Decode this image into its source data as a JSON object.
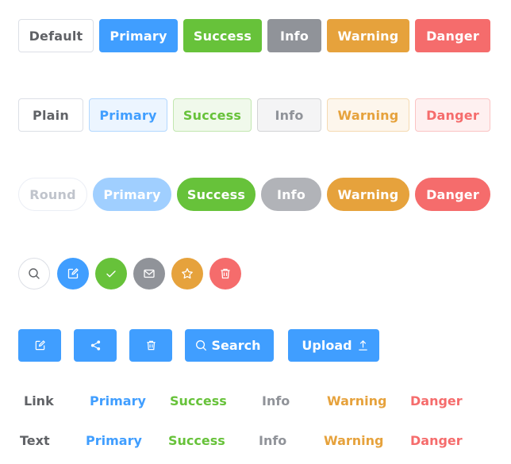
{
  "colors": {
    "primary": "#409eff",
    "success": "#67c23a",
    "info": "#909399",
    "warning": "#e6a23c",
    "danger": "#f56c6c",
    "default_text": "#606266"
  },
  "row_default": {
    "default": "Default",
    "primary": "Primary",
    "success": "Success",
    "info": "Info",
    "warning": "Warning",
    "danger": "Danger"
  },
  "row_plain": {
    "plain": "Plain",
    "primary": "Primary",
    "success": "Success",
    "info": "Info",
    "warning": "Warning",
    "danger": "Danger"
  },
  "row_round": {
    "round": "Round",
    "primary": "Primary",
    "success": "Success",
    "info": "Info",
    "warning": "Warning",
    "danger": "Danger"
  },
  "row_circle_icons": [
    "search-icon",
    "edit-icon",
    "check-icon",
    "message-icon",
    "star-icon",
    "delete-icon"
  ],
  "row_icon_buttons": {
    "icons": [
      "edit-icon",
      "share-icon",
      "delete-icon"
    ],
    "search_label": "Search",
    "upload_label": "Upload"
  },
  "row_link": {
    "default": "Link",
    "primary": "Primary",
    "success": "Success",
    "info": "Info",
    "warning": "Warning",
    "danger": "Danger"
  },
  "row_text": {
    "default": "Text",
    "primary": "Primary",
    "success": "Success",
    "info": "Info",
    "warning": "Warning",
    "danger": "Danger"
  }
}
